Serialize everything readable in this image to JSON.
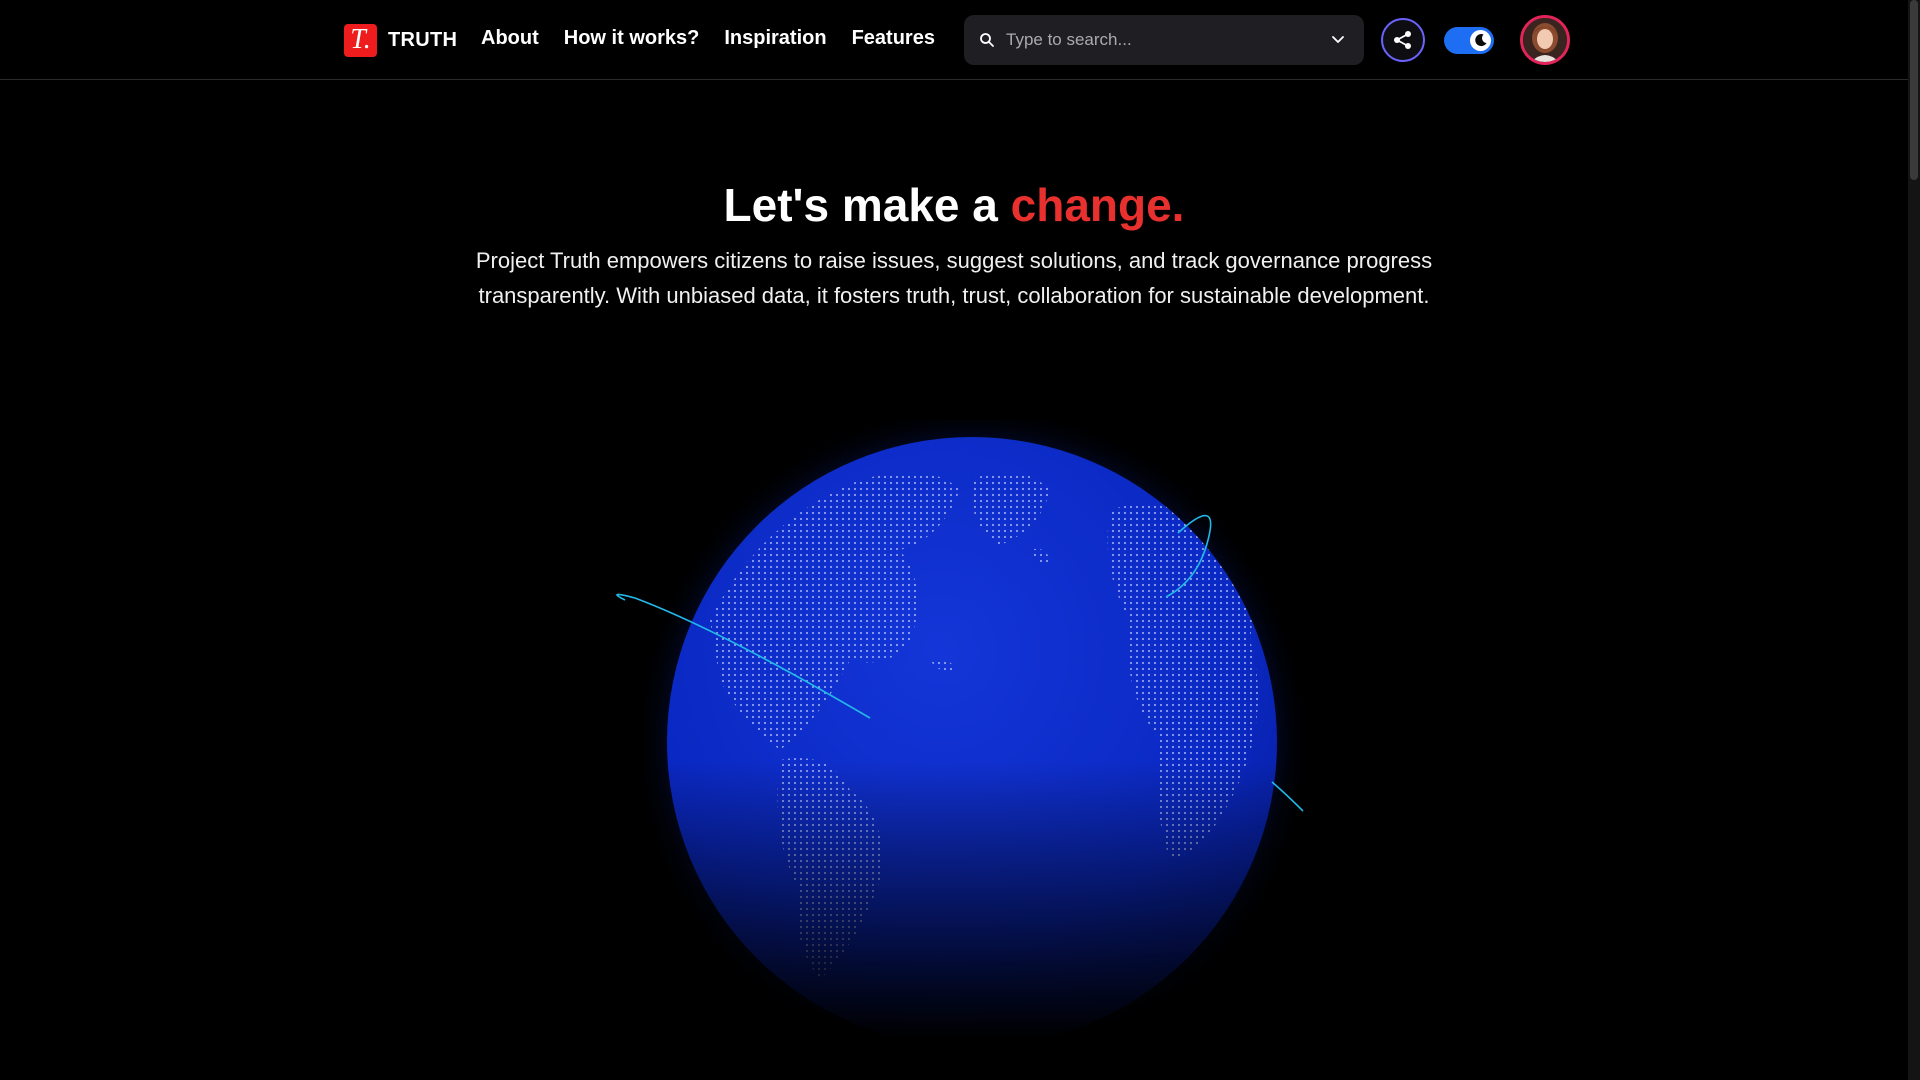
{
  "header": {
    "brand_letter": "T.",
    "brand_name": "TRUTH",
    "nav": [
      {
        "label": "About"
      },
      {
        "label": "How it works?"
      },
      {
        "label": "Inspiration"
      },
      {
        "label": "Features"
      }
    ],
    "search": {
      "placeholder": "Type to search..."
    },
    "share_icon": "share-icon",
    "theme_toggle": {
      "state": "dark",
      "icon": "moon-icon"
    },
    "avatar_icon": "user-avatar"
  },
  "hero": {
    "title_main": "Let's make a ",
    "title_accent": "change.",
    "description": "Project Truth empowers citizens to raise issues, suggest solutions, and track governance progress transparently. With unbiased data, it fosters truth, trust, collaboration for sustainable development."
  },
  "colors": {
    "background": "#000000",
    "accent_red": "#e8312f",
    "globe_blue": "#0a2fd6",
    "toggle_blue": "#1d6ef2",
    "share_ring": "#6b63ff",
    "avatar_ring": "#e2245a",
    "orbit_cyan": "#22b8e8"
  }
}
